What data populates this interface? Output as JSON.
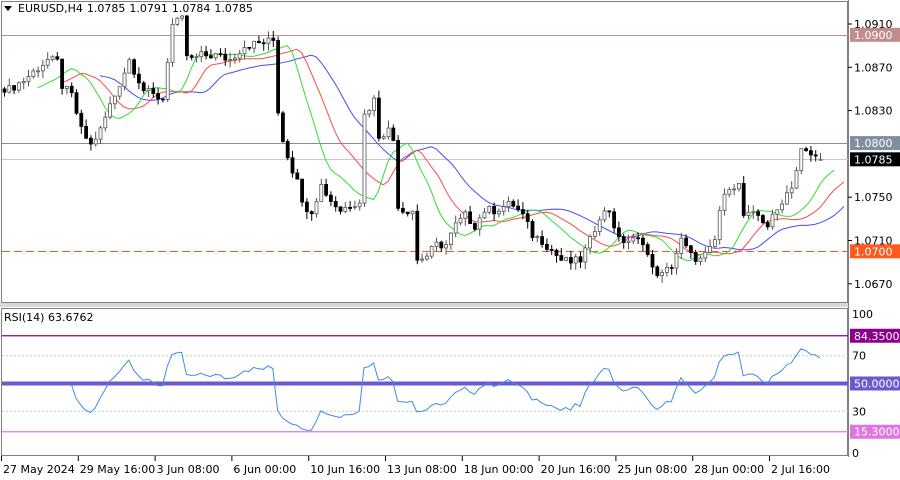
{
  "header": {
    "symbol": "EURUSD,H4",
    "open": "1.0785",
    "high": "1.0791",
    "low": "1.0784",
    "close": "1.0785"
  },
  "rsi_header": {
    "name": "RSI(14)",
    "value": "63.6762"
  },
  "colors": {
    "jaw": "#4a4aff",
    "teeth": "#ff4a4a",
    "lips": "#33dd33",
    "rsi": "#3c8ce6",
    "bull": "#ffffff",
    "bear": "#000000"
  },
  "chart_data": {
    "type": "candlestick",
    "symbol": "EURUSD",
    "timeframe": "H4",
    "price_ticks": [
      "1.0910",
      "1.0870",
      "1.0830",
      "1.0750",
      "1.0710",
      "1.0670"
    ],
    "price_range": [
      1.0648,
      1.093
    ],
    "x_tick_labels": [
      "27 May 2024",
      "29 May 16:00",
      "3 Jun 08:00",
      "6 Jun 00:00",
      "10 Jun 16:00",
      "13 Jun 08:00",
      "18 Jun 00:00",
      "20 Jun 16:00",
      "25 Jun 08:00",
      "28 Jun 00:00",
      "2 Jul 16:00"
    ],
    "bars_per_tick": 16,
    "close_keypoints": [
      [
        0,
        1.0847
      ],
      [
        4,
        1.0858
      ],
      [
        9,
        1.0877
      ],
      [
        11,
        1.0875
      ],
      [
        12,
        1.0853
      ],
      [
        14,
        1.0844
      ],
      [
        16,
        1.0812
      ],
      [
        18,
        1.0798
      ],
      [
        20,
        1.0812
      ],
      [
        22,
        1.0835
      ],
      [
        23,
        1.0844
      ],
      [
        26,
        1.0877
      ],
      [
        29,
        1.0849
      ],
      [
        31,
        1.0844
      ],
      [
        33,
        1.0841
      ],
      [
        34,
        1.0877
      ],
      [
        35,
        1.0909
      ],
      [
        37,
        1.0914
      ],
      [
        38,
        1.0881
      ],
      [
        39,
        1.0877
      ],
      [
        41,
        1.0881
      ],
      [
        44,
        1.0881
      ],
      [
        47,
        1.0877
      ],
      [
        50,
        1.089
      ],
      [
        54,
        1.0893
      ],
      [
        56,
        1.0895
      ],
      [
        57,
        1.083
      ],
      [
        58,
        1.0803
      ],
      [
        60,
        1.0775
      ],
      [
        61,
        1.077
      ],
      [
        62,
        1.0743
      ],
      [
        64,
        1.0738
      ],
      [
        66,
        1.0761
      ],
      [
        68,
        1.0747
      ],
      [
        70,
        1.0738
      ],
      [
        72,
        1.0743
      ],
      [
        74,
        1.0747
      ],
      [
        75,
        1.0826
      ],
      [
        77,
        1.084
      ],
      [
        78,
        1.0807
      ],
      [
        80,
        1.0812
      ],
      [
        81,
        1.0803
      ],
      [
        82,
        1.0743
      ],
      [
        83,
        1.0738
      ],
      [
        85,
        1.0738
      ],
      [
        86,
        1.0692
      ],
      [
        88,
        1.0696
      ],
      [
        90,
        1.0706
      ],
      [
        92,
        1.0706
      ],
      [
        94,
        1.0724
      ],
      [
        96,
        1.0733
      ],
      [
        98,
        1.0724
      ],
      [
        100,
        1.0738
      ],
      [
        102,
        1.0738
      ],
      [
        105,
        1.0743
      ],
      [
        106,
        1.0743
      ],
      [
        108,
        1.0733
      ],
      [
        110,
        1.0715
      ],
      [
        112,
        1.071
      ],
      [
        114,
        1.0701
      ],
      [
        116,
        1.0692
      ],
      [
        118,
        1.069
      ],
      [
        120,
        1.0692
      ],
      [
        122,
        1.071
      ],
      [
        124,
        1.0733
      ],
      [
        126,
        1.0738
      ],
      [
        128,
        1.071
      ],
      [
        131,
        1.071
      ],
      [
        133,
        1.071
      ],
      [
        135,
        1.0683
      ],
      [
        137,
        1.0678
      ],
      [
        139,
        1.0687
      ],
      [
        141,
        1.071
      ],
      [
        143,
        1.0696
      ],
      [
        145,
        1.0692
      ],
      [
        147,
        1.0701
      ],
      [
        148,
        1.071
      ],
      [
        149,
        1.0738
      ],
      [
        151,
        1.0761
      ],
      [
        153,
        1.0761
      ],
      [
        154,
        1.0733
      ],
      [
        156,
        1.0733
      ],
      [
        157,
        1.0733
      ],
      [
        159,
        1.0724
      ],
      [
        161,
        1.0738
      ],
      [
        162,
        1.0747
      ],
      [
        164,
        1.0761
      ],
      [
        165,
        1.0775
      ],
      [
        166,
        1.0793
      ],
      [
        168,
        1.0789
      ],
      [
        169,
        1.0787
      ],
      [
        170,
        1.0785
      ]
    ],
    "last_bar": {
      "open": 1.0785,
      "high": 1.0791,
      "low": 1.0784,
      "close": 1.0785
    },
    "indicators": [
      "Alligator (jaw blue, teeth red, lips green)",
      "RSI(14)"
    ],
    "levels": [
      {
        "label": "1.0900",
        "value": 1.09,
        "color": "#c08c8c",
        "style": "solid"
      },
      {
        "label": "1.0800",
        "value": 1.08,
        "color": "#7f8fa0",
        "style": "solid"
      },
      {
        "label": "1.0785",
        "value": 1.0785,
        "color": "#000000",
        "style": "bid"
      },
      {
        "label": "1.0700",
        "value": 1.07,
        "color": "#ff5a1e",
        "style": "dashed"
      }
    ],
    "rsi": {
      "ticks": [
        "100",
        "70",
        "30",
        "0"
      ],
      "range": [
        0,
        100
      ],
      "period": 14,
      "levels": [
        {
          "label": "84.3500",
          "value": 84.35,
          "color": "#8b008b"
        },
        {
          "label": "50.0000",
          "value": 50,
          "color": "#6a5acd"
        },
        {
          "label": "15.3000",
          "value": 15.3,
          "color": "#dd77dd"
        }
      ]
    }
  }
}
